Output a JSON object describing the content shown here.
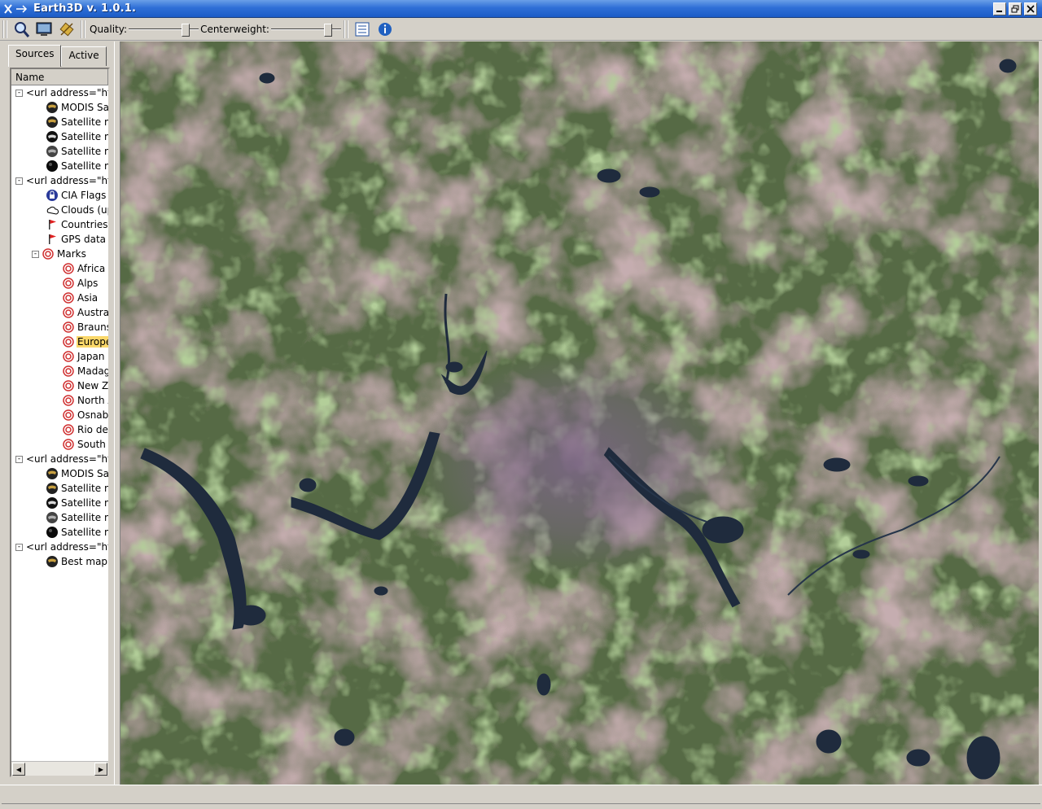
{
  "window": {
    "title": "Earth3D v. 1.0.1."
  },
  "toolbar": {
    "quality_label": "Quality:",
    "centerweight_label": "Centerweight:",
    "quality_level": 0.85,
    "centerweight_level": 0.85
  },
  "tabs": [
    {
      "label": "Sources"
    },
    {
      "label": "Active"
    }
  ],
  "tree": {
    "header": "Name",
    "rows": [
      {
        "label": "<url address=\"ht",
        "depth": 0,
        "expander": "-",
        "icon": "none"
      },
      {
        "label": "MODIS Sa",
        "depth": 1,
        "icon": "globe"
      },
      {
        "label": "Satellite m",
        "depth": 1,
        "icon": "globe"
      },
      {
        "label": "Satellite m",
        "depth": 1,
        "icon": "globe-dark"
      },
      {
        "label": "Satellite m",
        "depth": 1,
        "icon": "globe-gray"
      },
      {
        "label": "Satellite m",
        "depth": 1,
        "icon": "globe-black"
      },
      {
        "label": "<url address=\"ht",
        "depth": 0,
        "expander": "-",
        "icon": "none"
      },
      {
        "label": "CIA Flags",
        "depth": 1,
        "icon": "lock"
      },
      {
        "label": "Clouds (up",
        "depth": 1,
        "icon": "cloud"
      },
      {
        "label": "Countries",
        "depth": 1,
        "icon": "flag"
      },
      {
        "label": "GPS data",
        "depth": 1,
        "icon": "flag"
      },
      {
        "label": "Marks",
        "depth": 1,
        "expander": "-",
        "icon": "target"
      },
      {
        "label": "Africa",
        "depth": 2,
        "icon": "target"
      },
      {
        "label": "Alps",
        "depth": 2,
        "icon": "target"
      },
      {
        "label": "Asia",
        "depth": 2,
        "icon": "target"
      },
      {
        "label": "Austral",
        "depth": 2,
        "icon": "target"
      },
      {
        "label": "Brauns",
        "depth": 2,
        "icon": "target"
      },
      {
        "label": "Europe",
        "depth": 2,
        "icon": "target",
        "selected": true
      },
      {
        "label": "Japan",
        "depth": 2,
        "icon": "target"
      },
      {
        "label": "Madag",
        "depth": 2,
        "icon": "target"
      },
      {
        "label": "New Ze",
        "depth": 2,
        "icon": "target"
      },
      {
        "label": "North A",
        "depth": 2,
        "icon": "target"
      },
      {
        "label": "Osnabi",
        "depth": 2,
        "icon": "target"
      },
      {
        "label": "Rio de",
        "depth": 2,
        "icon": "target"
      },
      {
        "label": "South /",
        "depth": 2,
        "icon": "target"
      },
      {
        "label": "<url address=\"ht",
        "depth": 0,
        "expander": "-",
        "icon": "none"
      },
      {
        "label": "MODIS Sa",
        "depth": 1,
        "icon": "globe"
      },
      {
        "label": "Satellite m",
        "depth": 1,
        "icon": "globe"
      },
      {
        "label": "Satellite m",
        "depth": 1,
        "icon": "globe-dark"
      },
      {
        "label": "Satellite m",
        "depth": 1,
        "icon": "globe-gray"
      },
      {
        "label": "Satellite m",
        "depth": 1,
        "icon": "globe-black"
      },
      {
        "label": "<url address=\"ht",
        "depth": 0,
        "expander": "-",
        "icon": "none"
      },
      {
        "label": "Best map:",
        "depth": 1,
        "icon": "globe"
      }
    ]
  },
  "colors": {
    "titlebar": "#2f6fd6",
    "selection": "#fbd86a",
    "map_green": "#5a6e47",
    "map_pink": "#8f6a6c",
    "water": "#1e2a3c",
    "city": "#7d6688"
  }
}
